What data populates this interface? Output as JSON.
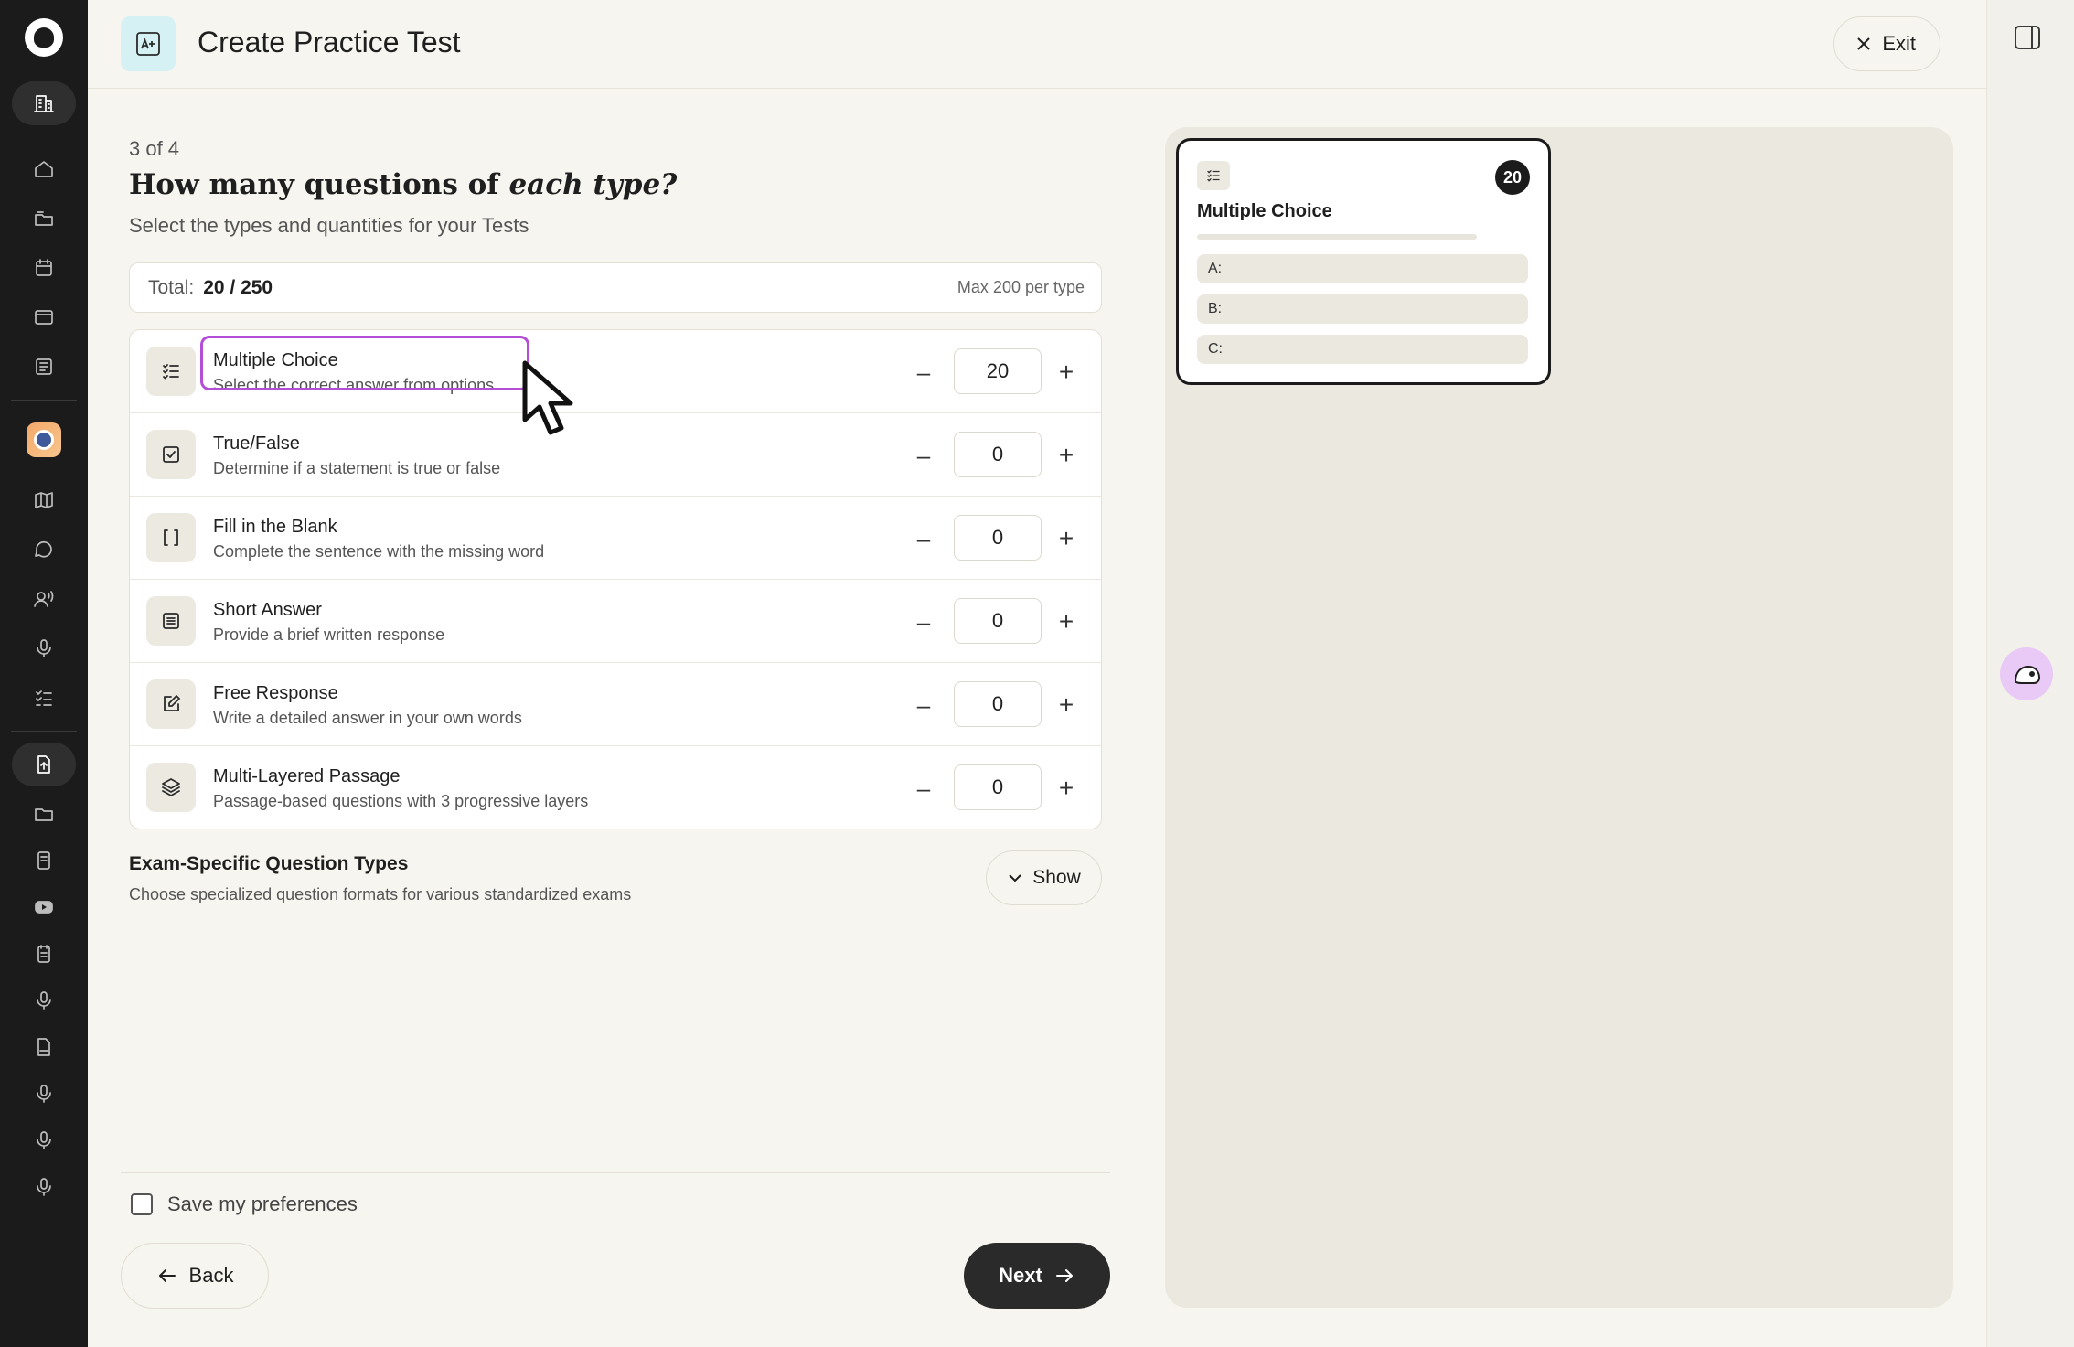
{
  "header": {
    "title": "Create Practice Test",
    "exit_label": "Exit"
  },
  "step": {
    "indicator": "3 of 4",
    "question_prefix": "How many questions of ",
    "question_emphasis": "each type?",
    "subtitle": "Select the types and quantities for your Tests"
  },
  "totals": {
    "label": "Total:",
    "value": "20 / 250",
    "max_label": "Max 200 per type"
  },
  "question_types": [
    {
      "name": "Multiple Choice",
      "description": "Select the correct answer from options",
      "count": "20",
      "icon": "list-check-icon"
    },
    {
      "name": "True/False",
      "description": "Determine if a statement is true or false",
      "count": "0",
      "icon": "checkbox-icon"
    },
    {
      "name": "Fill in the Blank",
      "description": "Complete the sentence with the missing word",
      "count": "0",
      "icon": "brackets-icon"
    },
    {
      "name": "Short Answer",
      "description": "Provide a brief written response",
      "count": "0",
      "icon": "text-lines-icon"
    },
    {
      "name": "Free Response",
      "description": "Write a detailed answer in your own words",
      "count": "0",
      "icon": "edit-icon"
    },
    {
      "name": "Multi-Layered Passage",
      "description": "Passage-based questions with 3 progressive layers",
      "count": "0",
      "icon": "layers-icon"
    }
  ],
  "stepper": {
    "minus": "–",
    "plus": "+"
  },
  "exam_specific": {
    "title": "Exam-Specific Question Types",
    "description": "Choose specialized question formats for various standardized exams",
    "toggle_label": "Show"
  },
  "footer": {
    "save_preferences_label": "Save my preferences",
    "back_label": "Back",
    "next_label": "Next"
  },
  "preview": {
    "card_title": "Multiple Choice",
    "count_badge": "20",
    "options": [
      "A:",
      "B:",
      "C:"
    ]
  },
  "colors": {
    "accent_highlight": "#b44ed6",
    "primary_button": "#2a2a2a",
    "rail_background": "#1b1b1b"
  }
}
